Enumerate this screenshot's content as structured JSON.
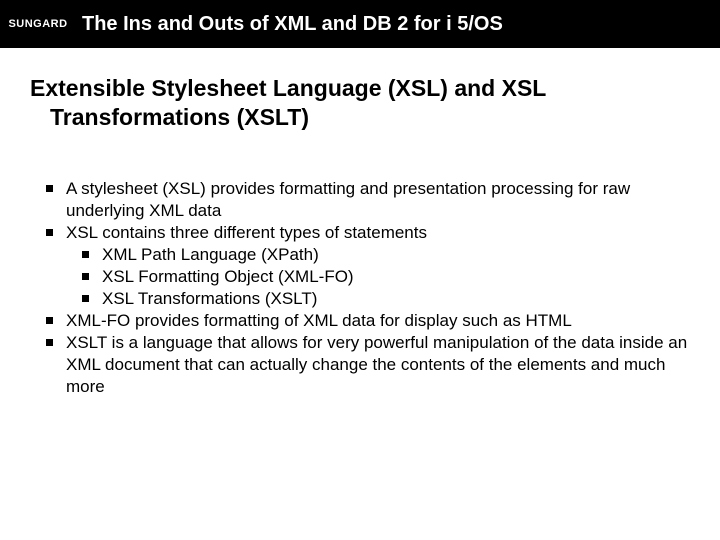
{
  "header": {
    "logo": "SUNGARD",
    "title": "The Ins and Outs of XML and DB 2 for i 5/OS"
  },
  "heading": {
    "line1": "Extensible Stylesheet Language (XSL) and XSL",
    "line2": "Transformations (XSLT)"
  },
  "bullets": [
    {
      "text": "A stylesheet (XSL) provides formatting and presentation processing for raw underlying XML data"
    },
    {
      "text": "XSL contains three different types of statements",
      "children": [
        {
          "text": "XML Path Language (XPath)"
        },
        {
          "text": "XSL Formatting Object (XML-FO)"
        },
        {
          "text": "XSL Transformations (XSLT)"
        }
      ]
    },
    {
      "text": "XML-FO provides formatting of XML data for display such as HTML"
    },
    {
      "text": "XSLT is a language that allows for very powerful manipulation of the data inside an XML document that can actually change the contents of the elements and much more"
    }
  ]
}
